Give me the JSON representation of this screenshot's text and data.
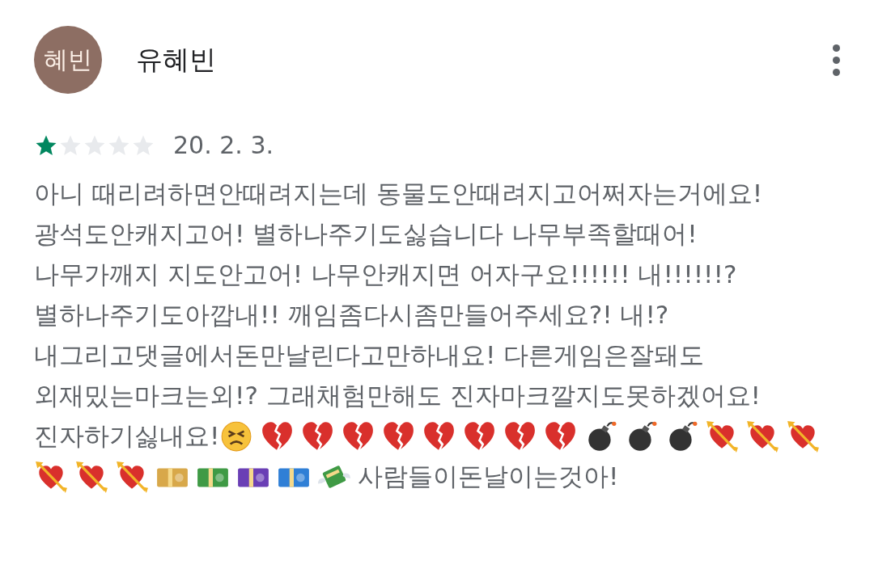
{
  "review": {
    "avatar_text": "혜빈",
    "author": "유혜빈",
    "stars": 1,
    "date": "20. 2. 3.",
    "lines": [
      [
        {
          "kind": "text",
          "text": "아니 때리려하면안때려지는데 동물도안때려지고어쩌자는거에요!"
        }
      ],
      [
        {
          "kind": "text",
          "text": "광석도안캐지고어! 별하나주기도싫습니다 나무부족할때어!"
        }
      ],
      [
        {
          "kind": "text",
          "text": "나무가깨지 지도안고어! 나무안캐지면 어자구요!!!!!! 내!!!!!!?"
        }
      ],
      [
        {
          "kind": "text",
          "text": "별하나주기도아깝내!! 깨임좀다시좀만들어주세요?! 내!?"
        }
      ],
      [
        {
          "kind": "text",
          "text": "내그리고댓글에서돈만날린다고만하내요! 다른게임은잘돼도"
        }
      ],
      [
        {
          "kind": "text",
          "text": "외재밌는마크는외!? 그래채험만해도 진자마크깔지도못하겠어요!"
        }
      ],
      [
        {
          "kind": "text",
          "text": "진자하기싫내요!"
        },
        {
          "kind": "persevering-face"
        },
        {
          "kind": "broken-heart"
        },
        {
          "kind": "broken-heart"
        },
        {
          "kind": "broken-heart"
        },
        {
          "kind": "broken-heart"
        },
        {
          "kind": "broken-heart"
        },
        {
          "kind": "broken-heart"
        },
        {
          "kind": "broken-heart"
        },
        {
          "kind": "broken-heart"
        },
        {
          "kind": "bomb"
        },
        {
          "kind": "bomb"
        },
        {
          "kind": "bomb"
        },
        {
          "kind": "heart-arrow"
        },
        {
          "kind": "heart-arrow"
        },
        {
          "kind": "heart-arrow"
        }
      ],
      [
        {
          "kind": "heart-arrow"
        },
        {
          "kind": "heart-arrow"
        },
        {
          "kind": "heart-arrow"
        },
        {
          "kind": "banknote",
          "color": "#d8a84a"
        },
        {
          "kind": "banknote",
          "color": "#3f9a45"
        },
        {
          "kind": "banknote",
          "color": "#6a3fb5"
        },
        {
          "kind": "banknote",
          "color": "#2f7fd6"
        },
        {
          "kind": "money-wings"
        },
        {
          "kind": "text",
          "text": " 사람들이돈날이는것아!"
        }
      ]
    ]
  }
}
